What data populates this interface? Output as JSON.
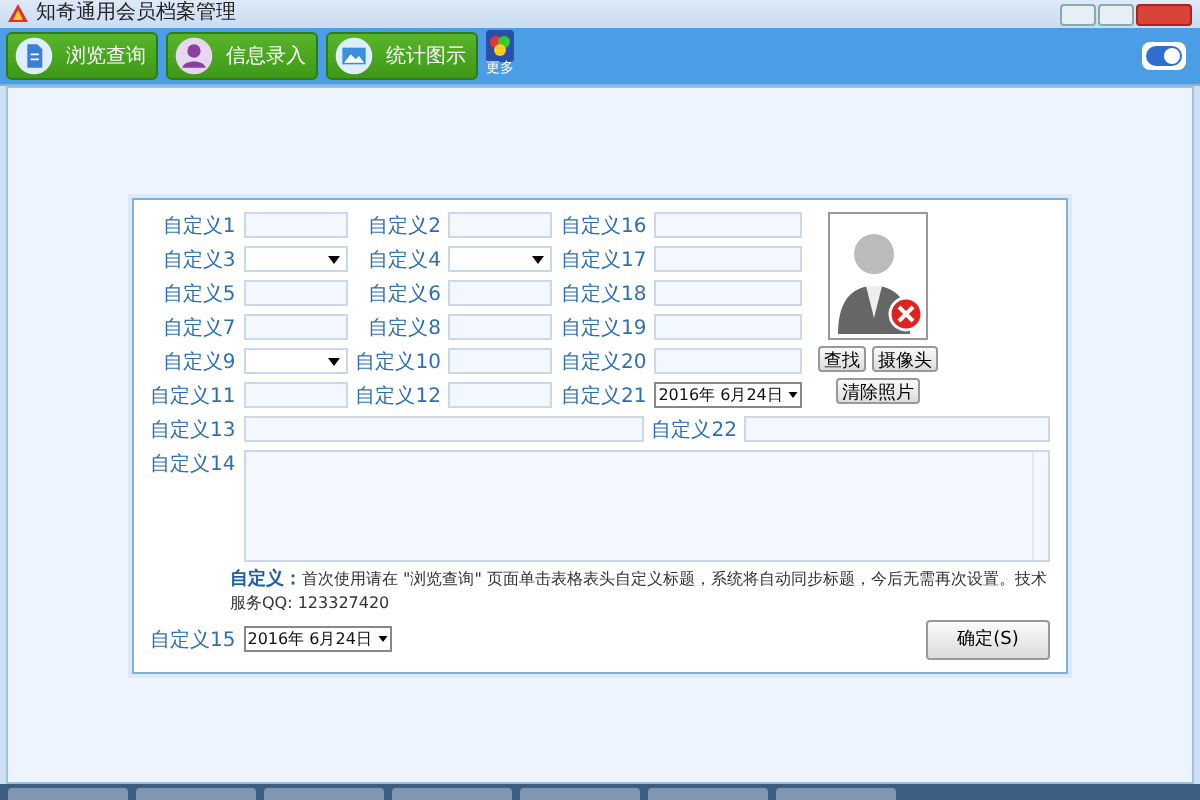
{
  "window": {
    "title": "知奇通用会员档案管理"
  },
  "toolbar": {
    "tabs": [
      {
        "label": "浏览查询"
      },
      {
        "label": "信息录入"
      },
      {
        "label": "统计图示"
      }
    ],
    "more": {
      "label": "更多"
    },
    "toggle": {
      "on": true
    }
  },
  "form": {
    "columns": [
      [
        {
          "label": "自定义1",
          "kind": "text"
        },
        {
          "label": "自定义3",
          "kind": "select"
        },
        {
          "label": "自定义5",
          "kind": "text"
        },
        {
          "label": "自定义7",
          "kind": "text"
        },
        {
          "label": "自定义9",
          "kind": "select"
        },
        {
          "label": "自定义11",
          "kind": "text"
        }
      ],
      [
        {
          "label": "自定义2",
          "kind": "text"
        },
        {
          "label": "自定义4",
          "kind": "select"
        },
        {
          "label": "自定义6",
          "kind": "text"
        },
        {
          "label": "自定义8",
          "kind": "text"
        },
        {
          "label": "自定义10",
          "kind": "text"
        },
        {
          "label": "自定义12",
          "kind": "text"
        }
      ],
      [
        {
          "label": "自定义16",
          "kind": "text"
        },
        {
          "label": "自定义17",
          "kind": "text"
        },
        {
          "label": "自定义18",
          "kind": "text"
        },
        {
          "label": "自定义19",
          "kind": "text"
        },
        {
          "label": "自定义20",
          "kind": "text"
        },
        {
          "label": "自定义21",
          "kind": "date",
          "value": "2016年 6月24日"
        }
      ]
    ],
    "photo": {
      "buttons": [
        "查找",
        "摄像头",
        "清除照片"
      ]
    },
    "wide_fields": [
      {
        "label": "自定义13"
      },
      {
        "label": "自定义22"
      }
    ],
    "notes": {
      "label": "自定义14"
    },
    "hint": "**自定义：**首次使用请在 \"浏览查询\" 页面单击表格表头自定义标题，系统将自动同步标题，今后无需再次设置。技术服务QQ: 123327420",
    "date_field": {
      "label": "自定义15",
      "value": "2016年 6月24日"
    },
    "confirm_button": "确定(S)"
  }
}
